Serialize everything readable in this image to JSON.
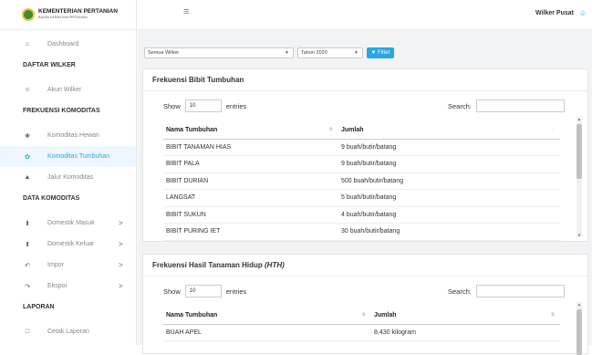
{
  "brand": {
    "title": "KEMENTERIAN PERTANIAN",
    "subtitle": "BADAN KARANTINA PERTANIAN"
  },
  "topbar": {
    "menu_icon": "hamburger-icon",
    "user": "Wilker Pusat"
  },
  "sidebar": {
    "dashboard": "Dashboard",
    "sec_wilker": "DAFTAR WILKER",
    "akun_wilker": "Akun Wilker",
    "sec_frekuensi": "FREKUENSI KOMODITAS",
    "komoditas_hewan": "Komoditas Hewan",
    "komoditas_tumbuhan": "Komoditas Tumbuhan",
    "jalur_komoditas": "Jalur Komoditas",
    "sec_data": "DATA KOMODITAS",
    "domestik_masuk": "Domestik Masuk",
    "domestik_keluar": "Domestik Keluar",
    "impor": "Impor",
    "ekspor": "Ekspor",
    "sec_laporan": "LAPORAN",
    "cetak_laporan": "Cetak Laporan",
    "chevron": ">"
  },
  "filters": {
    "wilker": "Semua Wilker",
    "tahun": "Tahun 2020",
    "button": "Filter",
    "caret": "▼"
  },
  "table1": {
    "title": "Frekuensi Bibit Tumbuhan",
    "show": "Show",
    "entries_value": "10",
    "entries": "entries",
    "search": "Search:",
    "col_name": "Nama Tumbuhan",
    "col_jumlah": "Jumlah",
    "rows": [
      [
        "BIBIT TANAMAN HIAS",
        "9 buah/butir/batang"
      ],
      [
        "BIBIT PALA",
        "9 buah/butir/batang"
      ],
      [
        "BIBIT DURIAN",
        "500 buah/butir/batang"
      ],
      [
        "LANGSAT",
        "5 buah/butir/batang"
      ],
      [
        "BIBIT SUKUN",
        "4 buah/butir/batang"
      ],
      [
        "BIBIT PURING IET",
        "30 buah/butir/batang"
      ]
    ]
  },
  "table2": {
    "title": "Frekuensi Hasil Tanaman Hidup",
    "title_suffix": "(HTH)",
    "show": "Show",
    "entries_value": "10",
    "entries": "entries",
    "search": "Search:",
    "col_name": "Nama Tumbuhan",
    "col_jumlah": "Jumlah",
    "rows": [
      [
        "BUAH APEL",
        "8,430 kilogram"
      ]
    ]
  }
}
